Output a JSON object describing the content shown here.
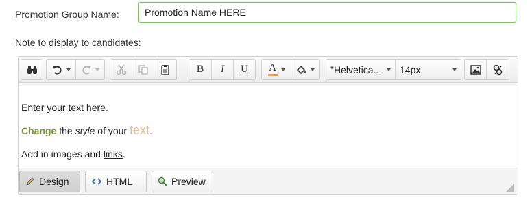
{
  "form": {
    "group_name_label": "Promotion Group Name:",
    "group_name_value": "Promotion Name HERE",
    "note_label": "Note to display to candidates:"
  },
  "toolbar": {
    "bold": "B",
    "italic": "I",
    "underline": "U",
    "font_color_glyph": "A",
    "font_family": "\"Helvetica...",
    "font_size": "14px",
    "underline_accent_color": "#e0a060",
    "icons": [
      "binoculars-icon",
      "undo-icon",
      "redo-icon",
      "cut-icon",
      "copy-icon",
      "paste-icon",
      "font-color-icon",
      "highlight-icon",
      "image-icon",
      "link-icon"
    ]
  },
  "content": {
    "line1": "Enter your text here.",
    "line2_change": "Change",
    "line2_the": " the ",
    "line2_style": "style",
    "line2_of_your": " of your ",
    "line2_text": "text",
    "line2_period": ".",
    "line3_prefix": "Add in images and ",
    "line3_link": "links",
    "line3_period": ".",
    "accent_green": "#7a9a3c",
    "accent_orange": "#e8b98e"
  },
  "modes": {
    "design": "Design",
    "html": "HTML",
    "preview": "Preview",
    "active": "Design"
  }
}
